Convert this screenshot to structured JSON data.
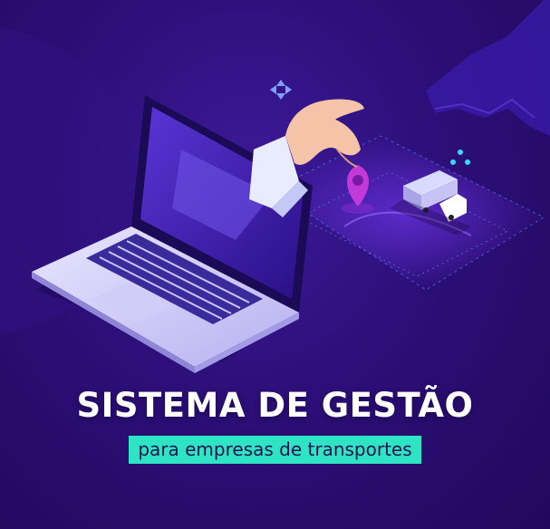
{
  "banner": {
    "title": "SISTEMA DE GESTÃO",
    "subtitle": "para empresas de transportes"
  },
  "colors": {
    "background": "#2a0e6b",
    "accent": "#2fe4c4",
    "title_text": "#ffffff",
    "subtitle_text": "#23124f",
    "pin": "#c13ad8"
  },
  "icons": [
    "laptop-icon",
    "hand-icon",
    "location-pin-icon",
    "truck-icon",
    "compass-arrows-icon",
    "dots-icon",
    "map-icon"
  ]
}
